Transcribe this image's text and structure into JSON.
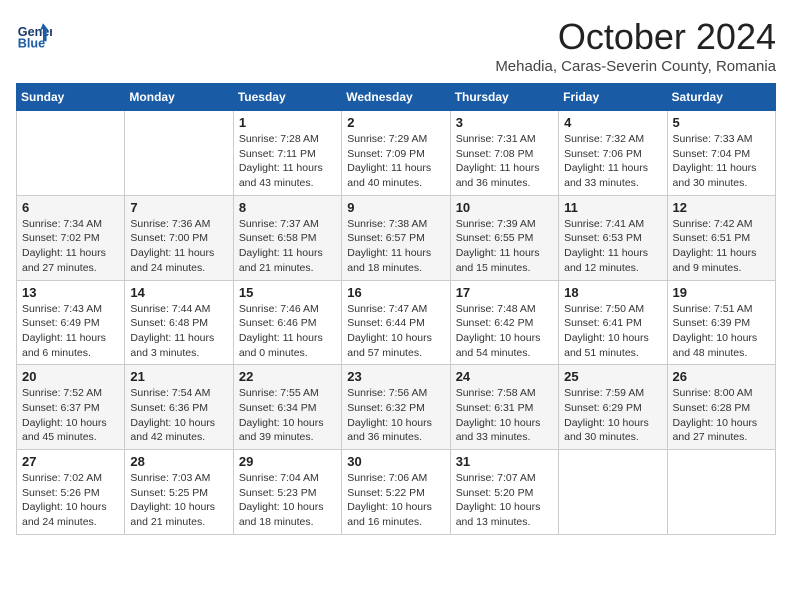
{
  "header": {
    "logo_line1": "General",
    "logo_line2": "Blue",
    "month_title": "October 2024",
    "location": "Mehadia, Caras-Severin County, Romania"
  },
  "days_of_week": [
    "Sunday",
    "Monday",
    "Tuesday",
    "Wednesday",
    "Thursday",
    "Friday",
    "Saturday"
  ],
  "weeks": [
    [
      {
        "day": null,
        "info": ""
      },
      {
        "day": null,
        "info": ""
      },
      {
        "day": "1",
        "info": "Sunrise: 7:28 AM\nSunset: 7:11 PM\nDaylight: 11 hours and 43 minutes."
      },
      {
        "day": "2",
        "info": "Sunrise: 7:29 AM\nSunset: 7:09 PM\nDaylight: 11 hours and 40 minutes."
      },
      {
        "day": "3",
        "info": "Sunrise: 7:31 AM\nSunset: 7:08 PM\nDaylight: 11 hours and 36 minutes."
      },
      {
        "day": "4",
        "info": "Sunrise: 7:32 AM\nSunset: 7:06 PM\nDaylight: 11 hours and 33 minutes."
      },
      {
        "day": "5",
        "info": "Sunrise: 7:33 AM\nSunset: 7:04 PM\nDaylight: 11 hours and 30 minutes."
      }
    ],
    [
      {
        "day": "6",
        "info": "Sunrise: 7:34 AM\nSunset: 7:02 PM\nDaylight: 11 hours and 27 minutes."
      },
      {
        "day": "7",
        "info": "Sunrise: 7:36 AM\nSunset: 7:00 PM\nDaylight: 11 hours and 24 minutes."
      },
      {
        "day": "8",
        "info": "Sunrise: 7:37 AM\nSunset: 6:58 PM\nDaylight: 11 hours and 21 minutes."
      },
      {
        "day": "9",
        "info": "Sunrise: 7:38 AM\nSunset: 6:57 PM\nDaylight: 11 hours and 18 minutes."
      },
      {
        "day": "10",
        "info": "Sunrise: 7:39 AM\nSunset: 6:55 PM\nDaylight: 11 hours and 15 minutes."
      },
      {
        "day": "11",
        "info": "Sunrise: 7:41 AM\nSunset: 6:53 PM\nDaylight: 11 hours and 12 minutes."
      },
      {
        "day": "12",
        "info": "Sunrise: 7:42 AM\nSunset: 6:51 PM\nDaylight: 11 hours and 9 minutes."
      }
    ],
    [
      {
        "day": "13",
        "info": "Sunrise: 7:43 AM\nSunset: 6:49 PM\nDaylight: 11 hours and 6 minutes."
      },
      {
        "day": "14",
        "info": "Sunrise: 7:44 AM\nSunset: 6:48 PM\nDaylight: 11 hours and 3 minutes."
      },
      {
        "day": "15",
        "info": "Sunrise: 7:46 AM\nSunset: 6:46 PM\nDaylight: 11 hours and 0 minutes."
      },
      {
        "day": "16",
        "info": "Sunrise: 7:47 AM\nSunset: 6:44 PM\nDaylight: 10 hours and 57 minutes."
      },
      {
        "day": "17",
        "info": "Sunrise: 7:48 AM\nSunset: 6:42 PM\nDaylight: 10 hours and 54 minutes."
      },
      {
        "day": "18",
        "info": "Sunrise: 7:50 AM\nSunset: 6:41 PM\nDaylight: 10 hours and 51 minutes."
      },
      {
        "day": "19",
        "info": "Sunrise: 7:51 AM\nSunset: 6:39 PM\nDaylight: 10 hours and 48 minutes."
      }
    ],
    [
      {
        "day": "20",
        "info": "Sunrise: 7:52 AM\nSunset: 6:37 PM\nDaylight: 10 hours and 45 minutes."
      },
      {
        "day": "21",
        "info": "Sunrise: 7:54 AM\nSunset: 6:36 PM\nDaylight: 10 hours and 42 minutes."
      },
      {
        "day": "22",
        "info": "Sunrise: 7:55 AM\nSunset: 6:34 PM\nDaylight: 10 hours and 39 minutes."
      },
      {
        "day": "23",
        "info": "Sunrise: 7:56 AM\nSunset: 6:32 PM\nDaylight: 10 hours and 36 minutes."
      },
      {
        "day": "24",
        "info": "Sunrise: 7:58 AM\nSunset: 6:31 PM\nDaylight: 10 hours and 33 minutes."
      },
      {
        "day": "25",
        "info": "Sunrise: 7:59 AM\nSunset: 6:29 PM\nDaylight: 10 hours and 30 minutes."
      },
      {
        "day": "26",
        "info": "Sunrise: 8:00 AM\nSunset: 6:28 PM\nDaylight: 10 hours and 27 minutes."
      }
    ],
    [
      {
        "day": "27",
        "info": "Sunrise: 7:02 AM\nSunset: 5:26 PM\nDaylight: 10 hours and 24 minutes."
      },
      {
        "day": "28",
        "info": "Sunrise: 7:03 AM\nSunset: 5:25 PM\nDaylight: 10 hours and 21 minutes."
      },
      {
        "day": "29",
        "info": "Sunrise: 7:04 AM\nSunset: 5:23 PM\nDaylight: 10 hours and 18 minutes."
      },
      {
        "day": "30",
        "info": "Sunrise: 7:06 AM\nSunset: 5:22 PM\nDaylight: 10 hours and 16 minutes."
      },
      {
        "day": "31",
        "info": "Sunrise: 7:07 AM\nSunset: 5:20 PM\nDaylight: 10 hours and 13 minutes."
      },
      {
        "day": null,
        "info": ""
      },
      {
        "day": null,
        "info": ""
      }
    ]
  ]
}
